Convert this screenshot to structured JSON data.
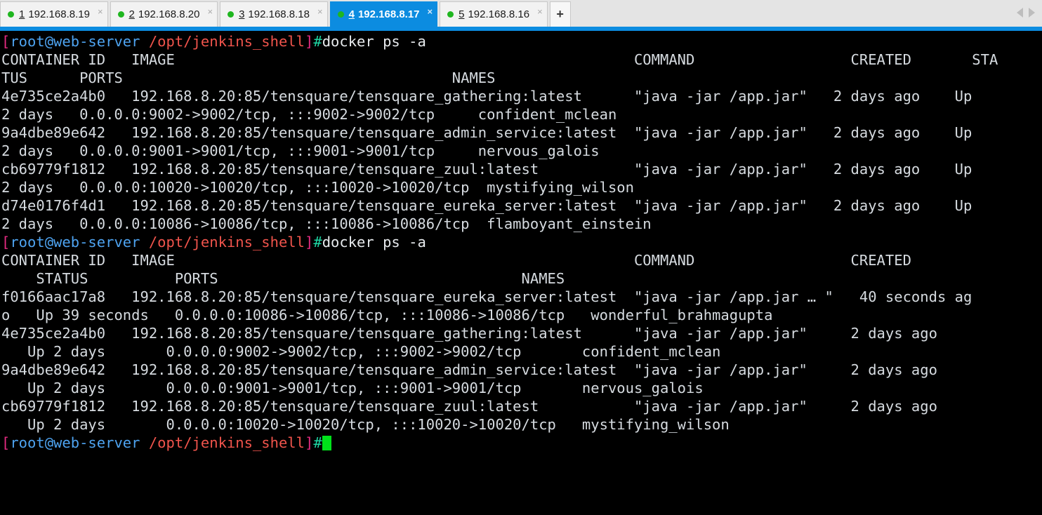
{
  "tabbar": {
    "tabs": [
      {
        "num": "1",
        "addr": "192.168.8.19",
        "active": false,
        "status": "connected"
      },
      {
        "num": "2",
        "addr": "192.168.8.20",
        "active": false,
        "status": "connected"
      },
      {
        "num": "3",
        "addr": "192.168.8.18",
        "active": false,
        "status": "connected"
      },
      {
        "num": "4",
        "addr": "192.168.8.17",
        "active": true,
        "status": "connected"
      },
      {
        "num": "5",
        "addr": "192.168.8.16",
        "active": false,
        "status": "connected"
      }
    ],
    "close_glyph": "×",
    "new_tab_label": "+",
    "nav_left_icon": "chevron-left-icon",
    "nav_right_icon": "chevron-right-icon",
    "active_tab_color": "#0c8ce0",
    "status_dot_color": "#1fb61f"
  },
  "terminal": {
    "prompt": {
      "open_bracket": "[",
      "user_host": "root@web-server",
      "space": " ",
      "path": "/opt/jenkins_shell",
      "close_bracket": "]",
      "hash": "#"
    },
    "colors": {
      "background": "#000000",
      "foreground": "#d6dbe0",
      "bracket": "#e52b82",
      "user_host": "#4ea3f0",
      "path": "#f0544c",
      "hash": "#1fd6a4",
      "cursor": "#00e21a"
    },
    "commands": {
      "first": "docker ps -a",
      "second": "docker ps -a"
    },
    "lines": [
      "CONTAINER ID   IMAGE                                                     COMMAND                  CREATED       STA",
      "TUS      PORTS                                      NAMES",
      "4e735ce2a4b0   192.168.8.20:85/tensquare/tensquare_gathering:latest      \"java -jar /app.jar\"   2 days ago    Up",
      "2 days   0.0.0.0:9002->9002/tcp, :::9002->9002/tcp     confident_mclean",
      "9a4dbe89e642   192.168.8.20:85/tensquare/tensquare_admin_service:latest  \"java -jar /app.jar\"   2 days ago    Up",
      "2 days   0.0.0.0:9001->9001/tcp, :::9001->9001/tcp     nervous_galois",
      "cb69779f1812   192.168.8.20:85/tensquare/tensquare_zuul:latest           \"java -jar /app.jar\"   2 days ago    Up",
      "2 days   0.0.0.0:10020->10020/tcp, :::10020->10020/tcp  mystifying_wilson",
      "d74e0176f4d1   192.168.8.20:85/tensquare/tensquare_eureka_server:latest  \"java -jar /app.jar\"   2 days ago    Up",
      "2 days   0.0.0.0:10086->10086/tcp, :::10086->10086/tcp  flamboyant_einstein"
    ],
    "lines2": [
      "CONTAINER ID   IMAGE                                                     COMMAND                  CREATED",
      "    STATUS          PORTS                                   NAMES",
      "f0166aac17a8   192.168.8.20:85/tensquare/tensquare_eureka_server:latest  \"java -jar /app.jar … \"   40 seconds ag",
      "o   Up 39 seconds   0.0.0.0:10086->10086/tcp, :::10086->10086/tcp   wonderful_brahmagupta",
      "4e735ce2a4b0   192.168.8.20:85/tensquare/tensquare_gathering:latest      \"java -jar /app.jar\"     2 days ago",
      "   Up 2 days       0.0.0.0:9002->9002/tcp, :::9002->9002/tcp       confident_mclean",
      "9a4dbe89e642   192.168.8.20:85/tensquare/tensquare_admin_service:latest  \"java -jar /app.jar\"     2 days ago",
      "   Up 2 days       0.0.0.0:9001->9001/tcp, :::9001->9001/tcp       nervous_galois",
      "cb69779f1812   192.168.8.20:85/tensquare/tensquare_zuul:latest           \"java -jar /app.jar\"     2 days ago",
      "   Up 2 days       0.0.0.0:10020->10020/tcp, :::10020->10020/tcp   mystifying_wilson"
    ]
  }
}
